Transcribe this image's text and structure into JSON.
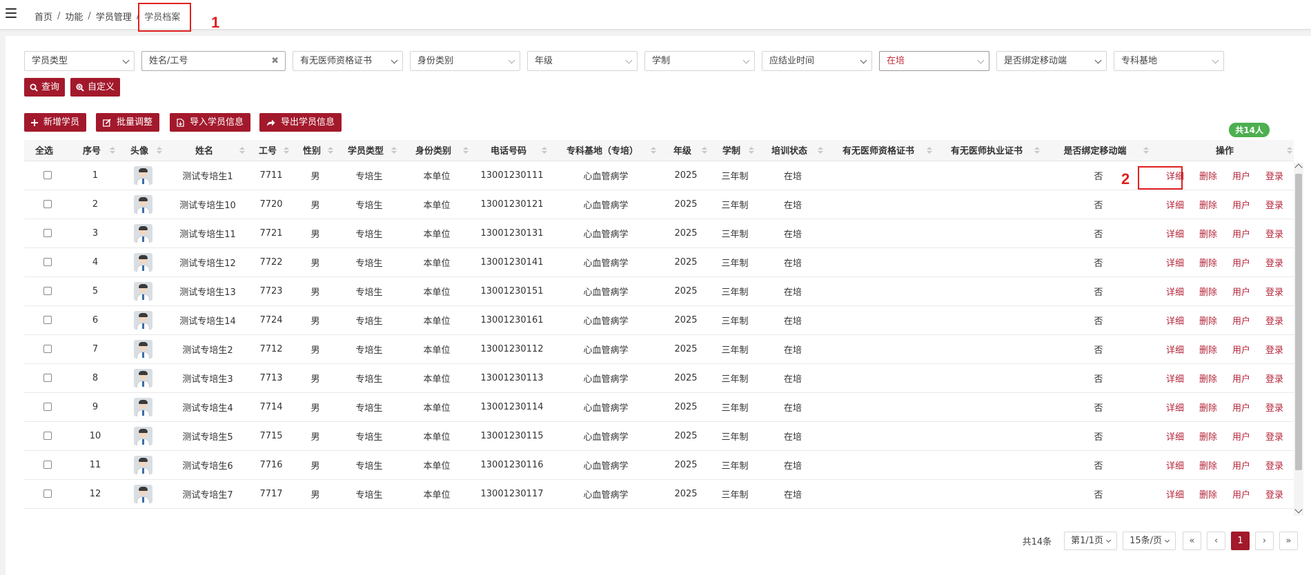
{
  "breadcrumb": [
    "首页",
    "功能",
    "学员管理",
    "学员档案"
  ],
  "annotations": {
    "mark1": "1",
    "mark2": "2"
  },
  "filters": {
    "student_type": "学员类型",
    "name_id_placeholder": "姓名/工号",
    "qualification_cert": "有无医师资格证书",
    "identity_type": "身份类别",
    "grade": "年级",
    "program_length": "学制",
    "graduation_time": "应结业时间",
    "training_status": "在培",
    "bind_mobile": "是否绑定移动端",
    "specialty_base": "专科基地",
    "query_btn": "查询",
    "custom_btn": "自定义"
  },
  "toolbar": {
    "add": "新增学员",
    "batch": "批量调整",
    "import": "导入学员信息",
    "export": "导出学员信息"
  },
  "total_badge": "共14人",
  "table": {
    "headers": [
      "全选",
      "序号",
      "头像",
      "姓名",
      "工号",
      "性别",
      "学员类型",
      "身份类别",
      "电话号码",
      "专科基地（专培）",
      "年级",
      "学制",
      "培训状态",
      "有无医师资格证书",
      "有无医师执业证书",
      "是否绑定移动端",
      "操作"
    ],
    "ops": [
      "详细",
      "删除",
      "用户",
      "登录"
    ],
    "rows": [
      [
        "1",
        "测试专培生1",
        "7711",
        "男",
        "专培生",
        "本单位",
        "13001230111",
        "心血管病学",
        "2025",
        "三年制",
        "在培",
        "",
        "",
        "否"
      ],
      [
        "2",
        "测试专培生10",
        "7720",
        "男",
        "专培生",
        "本单位",
        "13001230121",
        "心血管病学",
        "2025",
        "三年制",
        "在培",
        "",
        "",
        "否"
      ],
      [
        "3",
        "测试专培生11",
        "7721",
        "男",
        "专培生",
        "本单位",
        "13001230131",
        "心血管病学",
        "2025",
        "三年制",
        "在培",
        "",
        "",
        "否"
      ],
      [
        "4",
        "测试专培生12",
        "7722",
        "男",
        "专培生",
        "本单位",
        "13001230141",
        "心血管病学",
        "2025",
        "三年制",
        "在培",
        "",
        "",
        "否"
      ],
      [
        "5",
        "测试专培生13",
        "7723",
        "男",
        "专培生",
        "本单位",
        "13001230151",
        "心血管病学",
        "2025",
        "三年制",
        "在培",
        "",
        "",
        "否"
      ],
      [
        "6",
        "测试专培生14",
        "7724",
        "男",
        "专培生",
        "本单位",
        "13001230161",
        "心血管病学",
        "2025",
        "三年制",
        "在培",
        "",
        "",
        "否"
      ],
      [
        "7",
        "测试专培生2",
        "7712",
        "男",
        "专培生",
        "本单位",
        "13001230112",
        "心血管病学",
        "2025",
        "三年制",
        "在培",
        "",
        "",
        "否"
      ],
      [
        "8",
        "测试专培生3",
        "7713",
        "男",
        "专培生",
        "本单位",
        "13001230113",
        "心血管病学",
        "2025",
        "三年制",
        "在培",
        "",
        "",
        "否"
      ],
      [
        "9",
        "测试专培生4",
        "7714",
        "男",
        "专培生",
        "本单位",
        "13001230114",
        "心血管病学",
        "2025",
        "三年制",
        "在培",
        "",
        "",
        "否"
      ],
      [
        "10",
        "测试专培生5",
        "7715",
        "男",
        "专培生",
        "本单位",
        "13001230115",
        "心血管病学",
        "2025",
        "三年制",
        "在培",
        "",
        "",
        "否"
      ],
      [
        "11",
        "测试专培生6",
        "7716",
        "男",
        "专培生",
        "本单位",
        "13001230116",
        "心血管病学",
        "2025",
        "三年制",
        "在培",
        "",
        "",
        "否"
      ],
      [
        "12",
        "测试专培生7",
        "7717",
        "男",
        "专培生",
        "本单位",
        "13001230117",
        "心血管病学",
        "2025",
        "三年制",
        "在培",
        "",
        "",
        "否"
      ]
    ]
  },
  "pagination": {
    "total": "共14条",
    "page_info": "第1/1页",
    "page_size": "15条/页",
    "first": "«",
    "prev": "‹",
    "current": "1",
    "next": "›",
    "last": "»"
  },
  "colors": {
    "brand": "#a3192c",
    "link": "#b5263a",
    "badge": "#4caf50",
    "highlight": "#e02020"
  }
}
